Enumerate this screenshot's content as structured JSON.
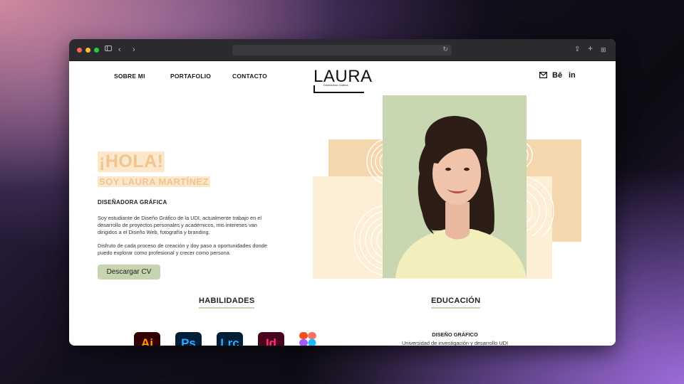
{
  "nav": {
    "about": "SOBRE MI",
    "portfolio": "PORTAFOLIO",
    "contact": "CONTACTO"
  },
  "logo": {
    "name": "LAURA",
    "subtitle": "Diseñadora Gráfica"
  },
  "social": {
    "mail_icon": "mail-icon",
    "behance": "Bē",
    "linkedin": "in"
  },
  "hero": {
    "greeting": "¡HOLA!",
    "intro": "SOY LAURA MARTÍNEZ",
    "role": "DISEÑADORA GRÁFICA",
    "para1": "Soy estudiante de Diseño Gráfico de la UDI, actualmente trabajo en el desarrollo de proyectos personales y académicos, mis intereses van dirigidos a el Diseño Web, fotografía y branding.",
    "para2": "Disfruto de cada proceso de creación y doy paso a oportunidades donde puedo explorar como profesional y crecer como persona.",
    "cv_button": "Descargar CV"
  },
  "skills": {
    "title": "HABILIDADES",
    "items": [
      {
        "label": "Ai",
        "name": "illustrator-icon",
        "bg": "#330000",
        "fg": "#ff9a00"
      },
      {
        "label": "Ps",
        "name": "photoshop-icon",
        "bg": "#001e36",
        "fg": "#31a8ff"
      },
      {
        "label": "Lrc",
        "name": "lightroom-icon",
        "bg": "#001e36",
        "fg": "#31a8ff"
      },
      {
        "label": "Id",
        "name": "indesign-icon",
        "bg": "#49021f",
        "fg": "#ff3366"
      }
    ],
    "figma_icon": "figma-icon"
  },
  "education": {
    "title": "EDUCACIÓN",
    "degree": "DISEÑO GRÁFICO",
    "institution": "Universidad de investigación y desarrollo UDI"
  },
  "colors": {
    "sage": "#c9d6b2",
    "peach": "#f5d7ad",
    "cream": "#fcefd6",
    "highlight_text": "#f2c48e"
  }
}
